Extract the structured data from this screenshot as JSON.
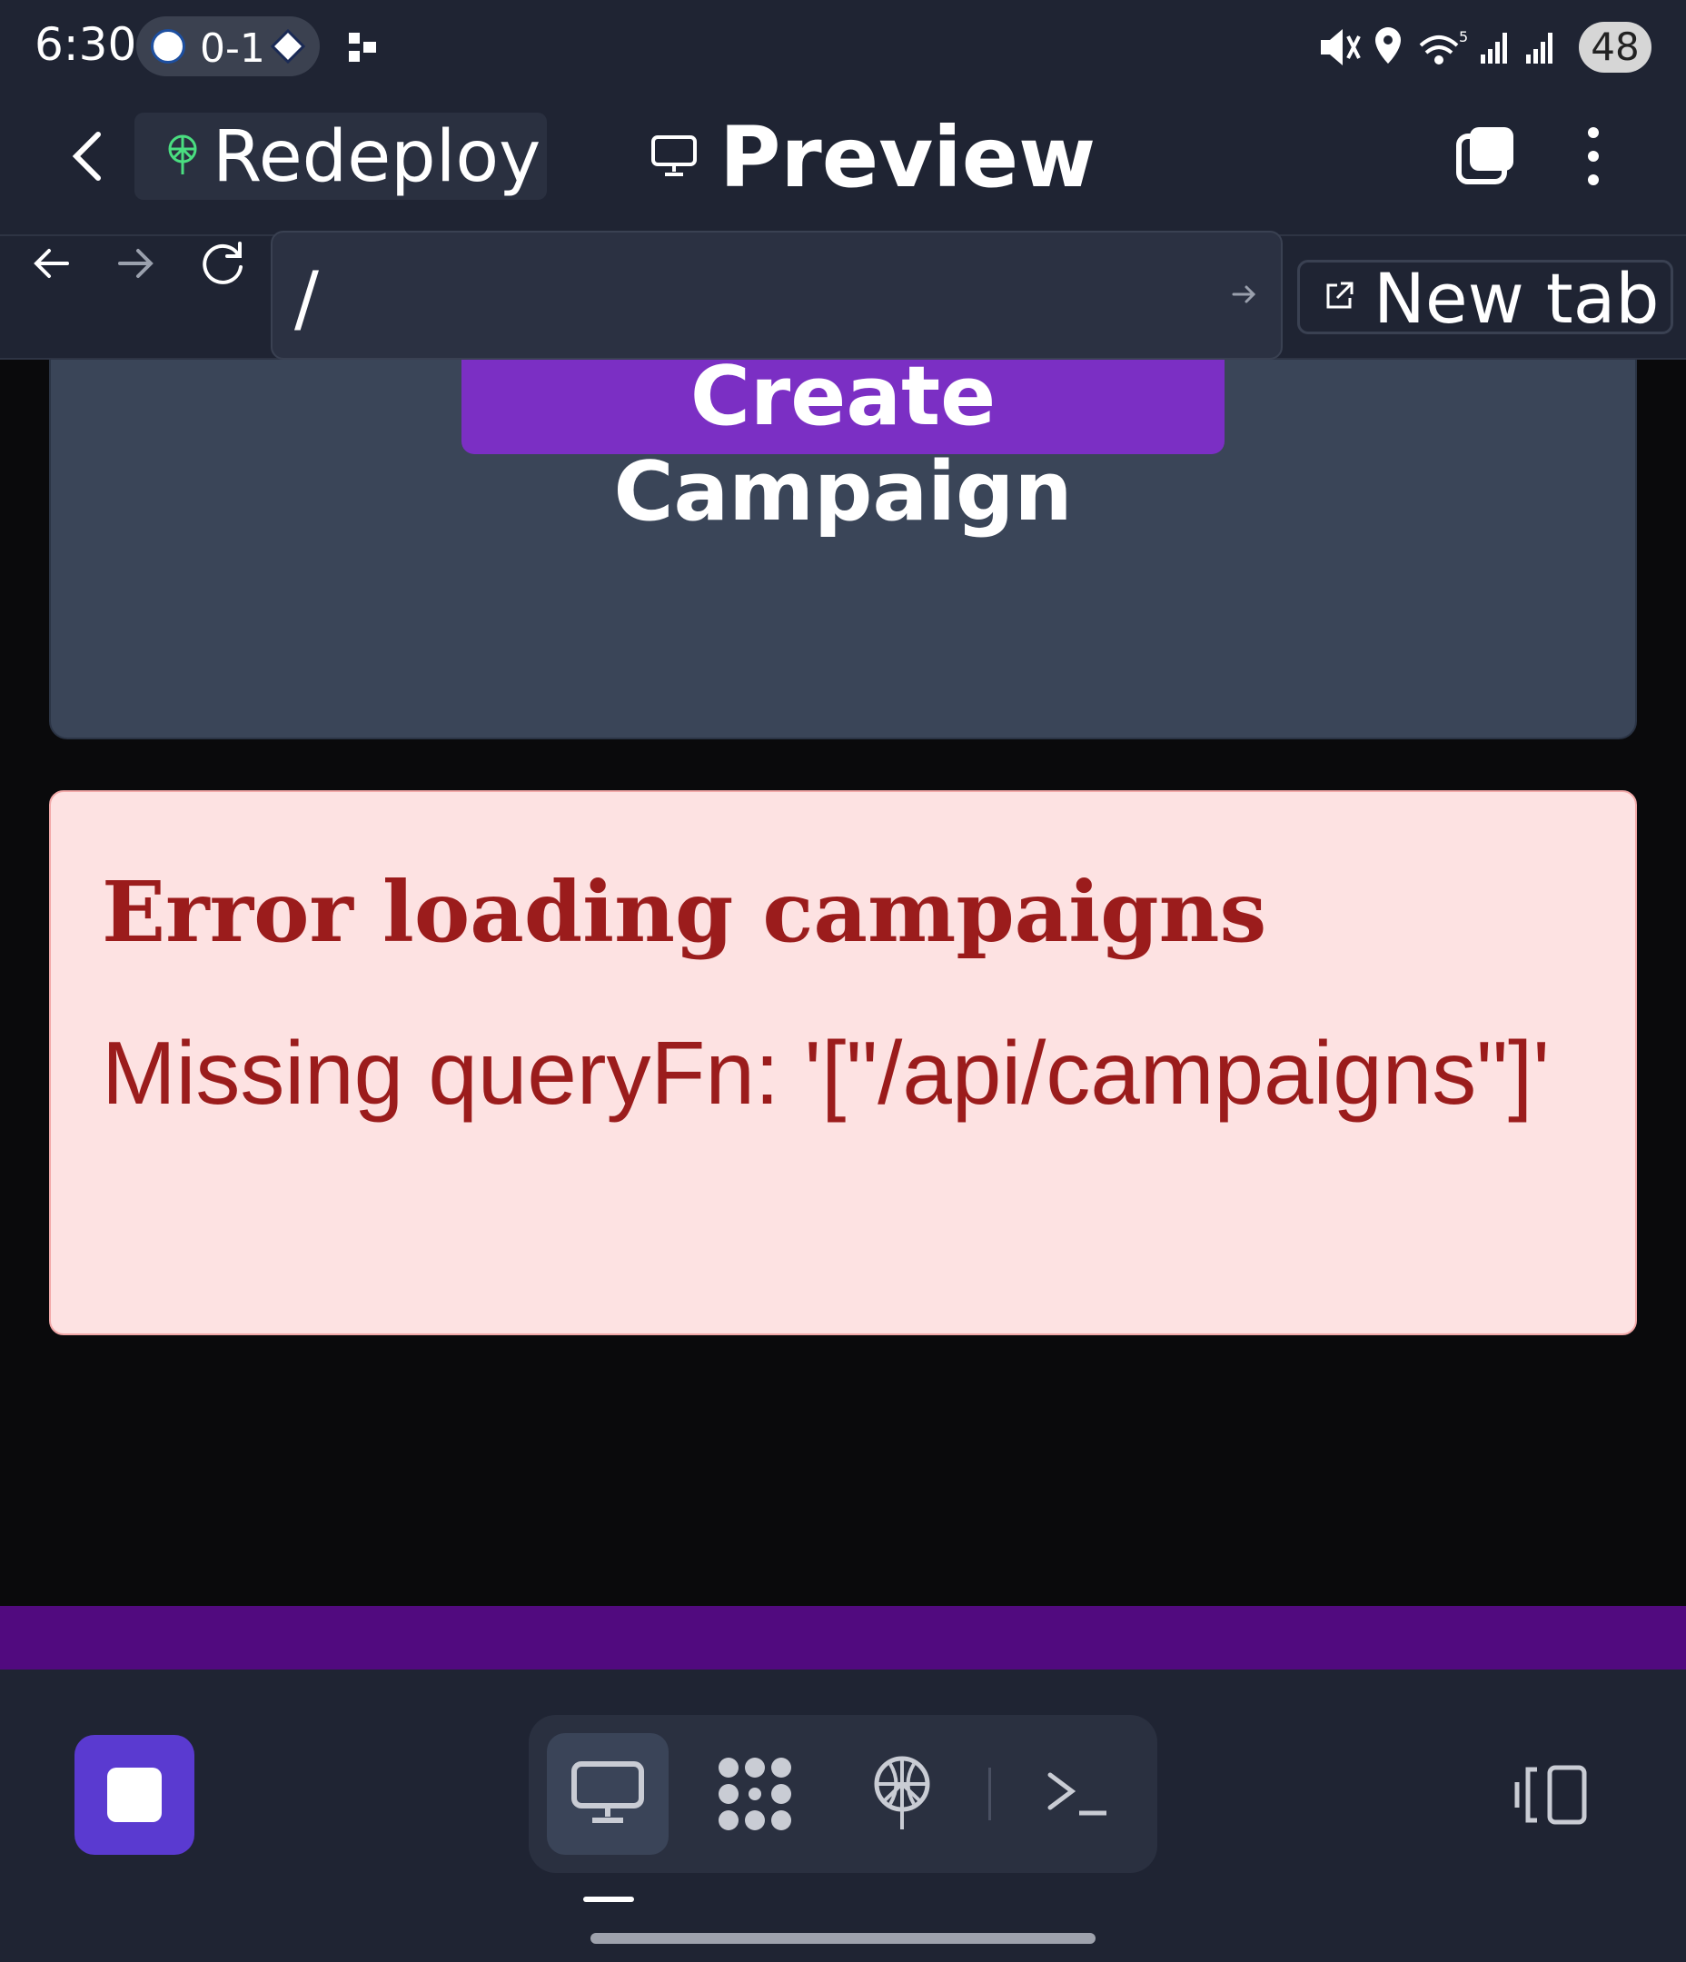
{
  "status_bar": {
    "time": "6:30",
    "score": "0-1",
    "battery": "48"
  },
  "header": {
    "redeploy_label": "Redeploy",
    "preview_label": "Preview"
  },
  "browser": {
    "url": "/",
    "new_tab_label": "New tab"
  },
  "page": {
    "create_button_label": "Create Campaign",
    "error": {
      "title": "Error loading campaigns",
      "message": "Missing queryFn: '[\"/api/campaigns\"]'"
    }
  },
  "colors": {
    "accent_purple": "#7b2fc4",
    "strip_purple": "#510a7f",
    "stop_button": "#5a3ad0",
    "error_text": "#9b1c1c",
    "error_bg": "#fde2e2"
  },
  "icons": {
    "status": [
      "mute-icon",
      "location-icon",
      "wifi-icon",
      "signal-icon",
      "signal-icon"
    ],
    "bottom_tools": [
      "preview-monitor-icon",
      "grid-dots-icon",
      "deploy-icon",
      "shell-icon"
    ]
  }
}
